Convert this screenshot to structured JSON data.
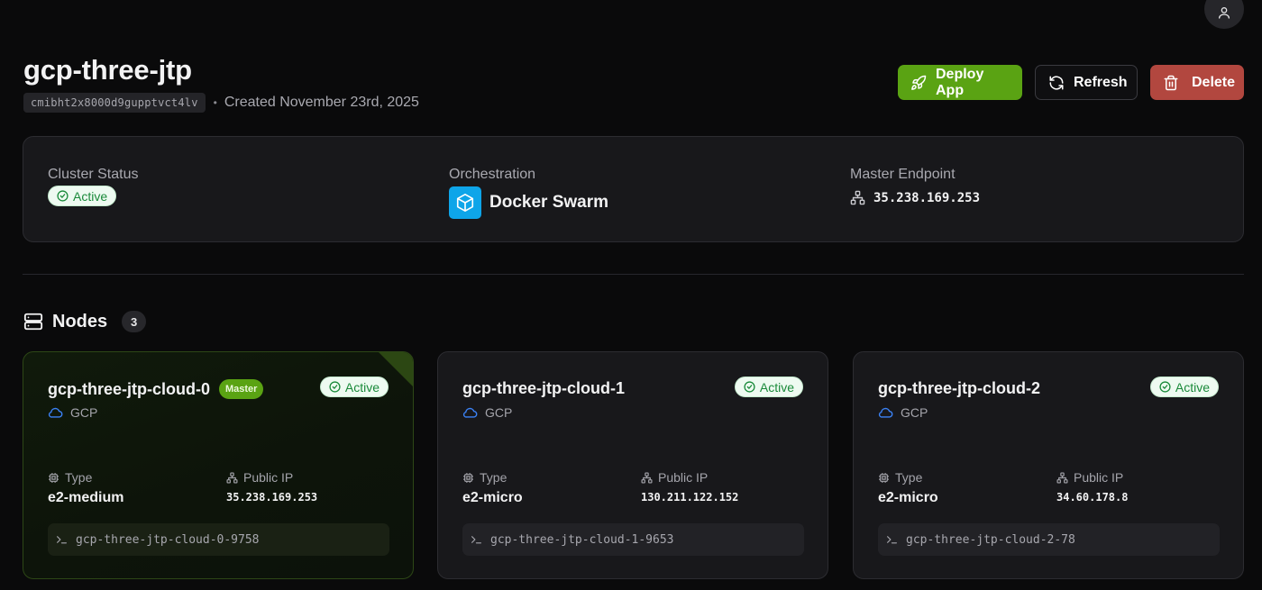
{
  "header": {
    "cluster_name": "gcp-three-jtp",
    "cluster_id": "cmibht2x8000d9gupptvct4lv",
    "separator": "•",
    "created": "Created November 23rd, 2025",
    "actions": {
      "deploy": "Deploy App",
      "refresh": "Refresh",
      "delete": "Delete"
    }
  },
  "summary": {
    "status_label": "Cluster Status",
    "status_value": "Active",
    "orchestration_label": "Orchestration",
    "orchestration_value": "Docker Swarm",
    "endpoint_label": "Master Endpoint",
    "endpoint_value": "35.238.169.253"
  },
  "nodes_section": {
    "title": "Nodes",
    "count": "3"
  },
  "nodes": [
    {
      "name": "gcp-three-jtp-cloud-0",
      "role_badge": "Master",
      "status": "Active",
      "provider": "GCP",
      "type_label": "Type",
      "type": "e2-medium",
      "ip_label": "Public IP",
      "ip": "35.238.169.253",
      "hostname": "gcp-three-jtp-cloud-0-9758"
    },
    {
      "name": "gcp-three-jtp-cloud-1",
      "status": "Active",
      "provider": "GCP",
      "type_label": "Type",
      "type": "e2-micro",
      "ip_label": "Public IP",
      "ip": "130.211.122.152",
      "hostname": "gcp-three-jtp-cloud-1-9653"
    },
    {
      "name": "gcp-three-jtp-cloud-2",
      "status": "Active",
      "provider": "GCP",
      "type_label": "Type",
      "type": "e2-micro",
      "ip_label": "Public IP",
      "ip": "34.60.178.8",
      "hostname": "gcp-three-jtp-cloud-2-78"
    }
  ],
  "icons": {
    "user": "user-icon",
    "deploy": "rocket-icon",
    "refresh": "refresh-icon",
    "delete": "trash-icon",
    "status": "check-circle-icon",
    "orchestration": "cube-icon",
    "endpoint": "network-icon",
    "nodes": "server-icon",
    "provider": "cloud-icon",
    "type": "cpu-icon",
    "ip": "network-icon",
    "hostname": "terminal-icon"
  },
  "colors": {
    "background": "#0a0a0b",
    "card": "#18181b",
    "accent_green": "#5aa313",
    "danger": "#b2473f",
    "active_badge_bg": "#eefaf1",
    "active_badge_text": "#1a8a3a",
    "docker_blue": "#0ea5e9",
    "cloud_blue": "#3b82f6"
  }
}
